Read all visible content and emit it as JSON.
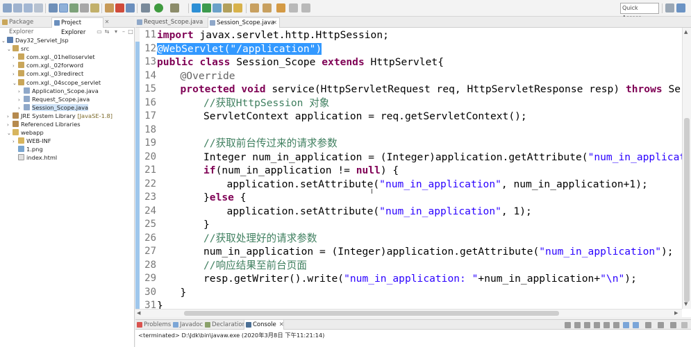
{
  "toolbar": {
    "quick_access": "Quick Access"
  },
  "explorer": {
    "tabs": [
      {
        "label": "Package Explorer",
        "icon": "package-icon",
        "active": false
      },
      {
        "label": "Project Explorer",
        "icon": "project-explorer-icon",
        "active": true
      }
    ],
    "tree": [
      {
        "label": "Day32_Serviet_Jsp",
        "depth": 0,
        "icon": "project-icon",
        "expanded": true
      },
      {
        "label": "src",
        "depth": 1,
        "icon": "source-folder-icon",
        "expanded": true
      },
      {
        "label": "com.xgl._01helloservlet",
        "depth": 2,
        "icon": "package-icon",
        "expanded": false
      },
      {
        "label": "com.xgl._02forword",
        "depth": 2,
        "icon": "package-icon",
        "expanded": false
      },
      {
        "label": "com.xgl._03redirect",
        "depth": 2,
        "icon": "package-icon",
        "expanded": false
      },
      {
        "label": "com.xgl._04scope_servlet",
        "depth": 2,
        "icon": "package-icon",
        "expanded": true
      },
      {
        "label": "Application_Scope.java",
        "depth": 3,
        "icon": "java-file-icon",
        "expanded": false
      },
      {
        "label": "Request_Scope.java",
        "depth": 3,
        "icon": "java-file-icon",
        "expanded": false
      },
      {
        "label": "Session_Scope.java",
        "depth": 3,
        "icon": "java-file-icon",
        "expanded": false,
        "selected": true
      },
      {
        "label": "JRE System Library",
        "note": "[JavaSE-1.8]",
        "depth": 1,
        "icon": "library-icon",
        "expanded": false
      },
      {
        "label": "Referenced Libraries",
        "depth": 1,
        "icon": "library-icon",
        "expanded": false
      },
      {
        "label": "webapp",
        "depth": 1,
        "icon": "folder-icon",
        "expanded": true
      },
      {
        "label": "WEB-INF",
        "depth": 2,
        "icon": "folder-icon",
        "expanded": false
      },
      {
        "label": "1.png",
        "depth": 2,
        "icon": "image-file-icon",
        "leaf": true
      },
      {
        "label": "index.html",
        "depth": 2,
        "icon": "html-file-icon",
        "leaf": true
      }
    ]
  },
  "editor": {
    "tabs": [
      {
        "label": "Request_Scope.java",
        "active": false
      },
      {
        "label": "Session_Scope.java",
        "active": true
      }
    ],
    "line_numbers": [
      "11",
      "12",
      "13",
      "14",
      "15",
      "16",
      "17",
      "18",
      "19",
      "20",
      "21",
      "22",
      "23",
      "24",
      "25",
      "26",
      "27",
      "28",
      "29",
      "30",
      "31"
    ],
    "lines": [
      {
        "indent": 0,
        "tokens": [
          {
            "t": "import ",
            "c": "kw"
          },
          {
            "t": "javax.servlet.http.HttpSession;",
            "c": ""
          }
        ]
      },
      {
        "indent": 0,
        "tokens": [
          {
            "t": "@WebServlet(\"/application\")",
            "c": "sel"
          }
        ]
      },
      {
        "indent": 0,
        "tokens": [
          {
            "t": "public ",
            "c": "kw"
          },
          {
            "t": "class ",
            "c": "kw"
          },
          {
            "t": "Session_Scope ",
            "c": ""
          },
          {
            "t": "extends ",
            "c": "kw"
          },
          {
            "t": "HttpServlet{",
            "c": ""
          }
        ]
      },
      {
        "indent": 1,
        "tokens": [
          {
            "t": "@Override",
            "c": "an"
          }
        ]
      },
      {
        "indent": 1,
        "tokens": [
          {
            "t": "protected ",
            "c": "kw"
          },
          {
            "t": "void ",
            "c": "kw"
          },
          {
            "t": "service(HttpServletRequest ",
            "c": ""
          },
          {
            "t": "req",
            "c": ""
          },
          {
            "t": ", HttpServletResponse ",
            "c": ""
          },
          {
            "t": "resp",
            "c": ""
          },
          {
            "t": ") ",
            "c": ""
          },
          {
            "t": "throws ",
            "c": "kw"
          },
          {
            "t": "Servle",
            "c": ""
          }
        ]
      },
      {
        "indent": 2,
        "tokens": [
          {
            "t": "//获取HttpSession 对象",
            "c": "cm"
          }
        ]
      },
      {
        "indent": 2,
        "tokens": [
          {
            "t": "ServletContext ",
            "c": ""
          },
          {
            "t": "application",
            "c": ""
          },
          {
            "t": " = ",
            "c": ""
          },
          {
            "t": "req",
            "c": ""
          },
          {
            "t": ".getServletContext();",
            "c": ""
          }
        ]
      },
      {
        "indent": 0,
        "tokens": []
      },
      {
        "indent": 2,
        "tokens": [
          {
            "t": "//获取前台传过来的请求参数",
            "c": "cm"
          }
        ]
      },
      {
        "indent": 2,
        "tokens": [
          {
            "t": "Integer ",
            "c": ""
          },
          {
            "t": "num_in_application",
            "c": ""
          },
          {
            "t": " = (Integer)",
            "c": ""
          },
          {
            "t": "application",
            "c": ""
          },
          {
            "t": ".getAttribute(",
            "c": ""
          },
          {
            "t": "\"num_in_applicatio",
            "c": "st"
          }
        ]
      },
      {
        "indent": 2,
        "tokens": [
          {
            "t": "if",
            "c": "kw"
          },
          {
            "t": "(",
            "c": ""
          },
          {
            "t": "num_in_application",
            "c": ""
          },
          {
            "t": " != ",
            "c": ""
          },
          {
            "t": "null",
            "c": "kw"
          },
          {
            "t": ") {",
            "c": ""
          }
        ]
      },
      {
        "indent": 3,
        "tokens": [
          {
            "t": "application",
            "c": ""
          },
          {
            "t": ".setAttribute(",
            "c": ""
          },
          {
            "t": "\"num_in_application\"",
            "c": "st"
          },
          {
            "t": ", ",
            "c": ""
          },
          {
            "t": "num_in_application",
            "c": ""
          },
          {
            "t": "+1);",
            "c": ""
          }
        ]
      },
      {
        "indent": 2,
        "tokens": [
          {
            "t": "}",
            "c": ""
          },
          {
            "t": "else ",
            "c": "kw"
          },
          {
            "t": "{",
            "c": ""
          }
        ]
      },
      {
        "indent": 3,
        "tokens": [
          {
            "t": "application",
            "c": ""
          },
          {
            "t": ".setAttribute(",
            "c": ""
          },
          {
            "t": "\"num_in_application\"",
            "c": "st"
          },
          {
            "t": ", 1);",
            "c": ""
          }
        ]
      },
      {
        "indent": 2,
        "tokens": [
          {
            "t": "}",
            "c": ""
          }
        ]
      },
      {
        "indent": 2,
        "tokens": [
          {
            "t": "//获取处理好的请求参数",
            "c": "cm"
          }
        ]
      },
      {
        "indent": 2,
        "tokens": [
          {
            "t": "num_in_application",
            "c": ""
          },
          {
            "t": " = (Integer)",
            "c": ""
          },
          {
            "t": "application",
            "c": ""
          },
          {
            "t": ".getAttribute(",
            "c": ""
          },
          {
            "t": "\"num_in_application\"",
            "c": "st"
          },
          {
            "t": ");",
            "c": ""
          }
        ]
      },
      {
        "indent": 2,
        "tokens": [
          {
            "t": "//响应结果至前台页面",
            "c": "cm"
          }
        ]
      },
      {
        "indent": 2,
        "tokens": [
          {
            "t": "resp",
            "c": ""
          },
          {
            "t": ".getWriter().write(",
            "c": ""
          },
          {
            "t": "\"num_in_application: \"",
            "c": "st"
          },
          {
            "t": "+",
            "c": ""
          },
          {
            "t": "num_in_application",
            "c": ""
          },
          {
            "t": "+",
            "c": ""
          },
          {
            "t": "\"\\n\"",
            "c": "st"
          },
          {
            "t": ");",
            "c": ""
          }
        ]
      },
      {
        "indent": 1,
        "tokens": [
          {
            "t": "}",
            "c": ""
          }
        ]
      },
      {
        "indent": 0,
        "tokens": [
          {
            "t": "}",
            "c": ""
          }
        ]
      }
    ]
  },
  "bottom_panel": {
    "tabs": [
      {
        "label": "Problems",
        "active": false
      },
      {
        "label": "Javadoc",
        "active": false
      },
      {
        "label": "Declaration",
        "active": false
      },
      {
        "label": "Console",
        "active": true
      }
    ],
    "status": "<terminated> D:\\Jdk\\bin\\javaw.exe (2020年3月8日 下午11:21:14)"
  },
  "colors": {
    "keyword": "#7f0055",
    "annotation": "#646464",
    "comment": "#3f7f5f",
    "string": "#2a00ff",
    "selection": "#3399ff"
  }
}
